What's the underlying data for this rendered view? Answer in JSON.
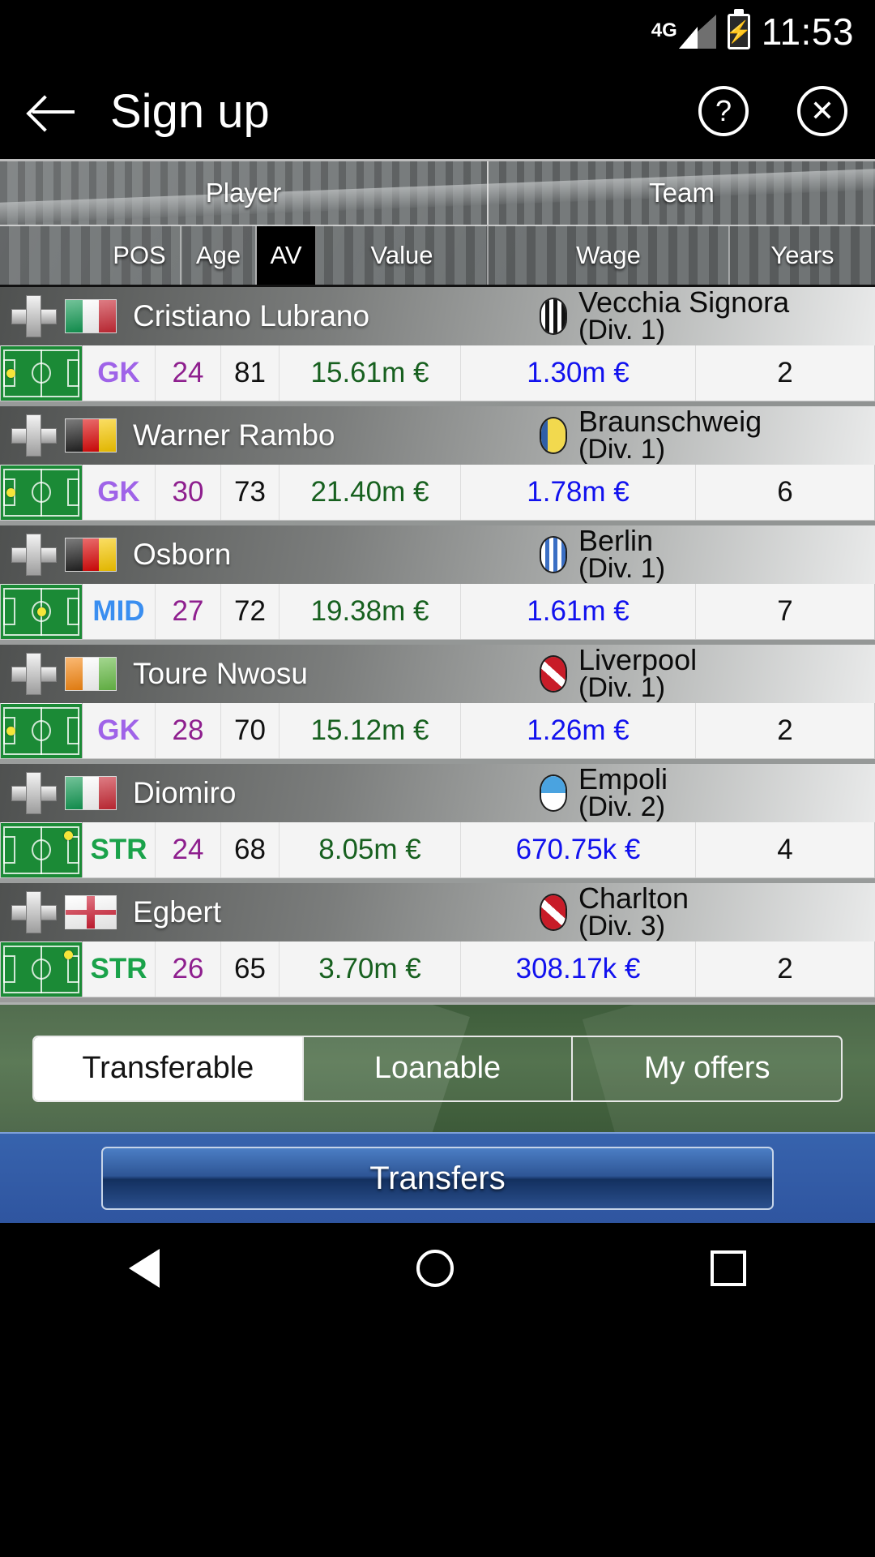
{
  "status_bar": {
    "network": "4G",
    "time": "11:53",
    "battery_icon": "battery-charging-icon"
  },
  "app_bar": {
    "title": "Sign up",
    "back_icon": "back-arrow-icon",
    "help_icon": "help-circle-icon",
    "help_glyph": "?",
    "close_icon": "close-circle-icon",
    "close_glyph": "✕"
  },
  "table": {
    "groups": [
      {
        "label": "Player"
      },
      {
        "label": "Team"
      }
    ],
    "columns": [
      {
        "label": "POS",
        "selected": false
      },
      {
        "label": "Age",
        "selected": false
      },
      {
        "label": "AV",
        "selected": true
      },
      {
        "label": "Value",
        "selected": false
      },
      {
        "label": "Wage",
        "selected": false
      },
      {
        "label": "Years",
        "selected": false
      }
    ],
    "rows": [
      {
        "name": "Cristiano Lubrano",
        "nation": "Italy",
        "team": "Vecchia Signora",
        "division": "(Div. 1)",
        "pos": "GK",
        "age": "24",
        "av": "81",
        "value": "15.61m €",
        "wage": "1.30m €",
        "years": "2"
      },
      {
        "name": "Warner Rambo",
        "nation": "Germany",
        "team": "Braunschweig",
        "division": "(Div. 1)",
        "pos": "GK",
        "age": "30",
        "av": "73",
        "value": "21.40m €",
        "wage": "1.78m €",
        "years": "6"
      },
      {
        "name": "Osborn",
        "nation": "Germany",
        "team": "Berlin",
        "division": "(Div. 1)",
        "pos": "MID",
        "age": "27",
        "av": "72",
        "value": "19.38m €",
        "wage": "1.61m €",
        "years": "7"
      },
      {
        "name": "Toure Nwosu",
        "nation": "Ivory Coast",
        "team": "Liverpool",
        "division": "(Div. 1)",
        "pos": "GK",
        "age": "28",
        "av": "70",
        "value": "15.12m €",
        "wage": "1.26m €",
        "years": "2"
      },
      {
        "name": "Diomiro",
        "nation": "Italy",
        "team": "Empoli",
        "division": "(Div. 2)",
        "pos": "STR",
        "age": "24",
        "av": "68",
        "value": "8.05m €",
        "wage": "670.75k €",
        "years": "4"
      },
      {
        "name": "Egbert",
        "nation": "England",
        "team": "Charlton",
        "division": "(Div. 3)",
        "pos": "STR",
        "age": "26",
        "av": "65",
        "value": "3.70m €",
        "wage": "308.17k €",
        "years": "2"
      }
    ]
  },
  "tabs": [
    {
      "label": "Transferable",
      "active": true
    },
    {
      "label": "Loanable",
      "active": false
    },
    {
      "label": "My offers",
      "active": false
    }
  ],
  "action_button": {
    "label": "Transfers"
  },
  "nav_bar": {
    "back_icon": "nav-back-icon",
    "home_icon": "nav-home-icon",
    "recents_icon": "nav-recents-icon"
  },
  "colors": {
    "pos_gk": "#9f63e8",
    "pos_mid": "#3a8ef0",
    "pos_str": "#1aa24a",
    "age": "#8e1f8e",
    "value": "#17601f",
    "wage": "#1111ee",
    "accent_blue": "#2f55a0",
    "pitch_green": "#1b8a36"
  },
  "flags": {
    "Italy": [
      "#009246",
      "#ffffff",
      "#ce2b37"
    ],
    "Germany": [
      "#111111",
      "#dd0000",
      "#ffce00"
    ],
    "Ivory Coast": [
      "#f77f00",
      "#ffffff",
      "#6cc24a"
    ],
    "England": [
      "cross",
      "#ffffff",
      "#cf142b"
    ]
  },
  "shields": {
    "Vecchia Signora": [
      "stripes-bw",
      "#ffffff",
      "#111111"
    ],
    "Braunschweig": [
      "solid-split",
      "#f2d94e",
      "#2f5fa8"
    ],
    "Berlin": [
      "stripes-bw",
      "#ffffff",
      "#3b6fc4"
    ],
    "Liverpool": [
      "diag",
      "#c81c28",
      "#ffffff"
    ],
    "Empoli": [
      "halves",
      "#4aa3e0",
      "#ffffff"
    ],
    "Charlton": [
      "diag",
      "#c81c28",
      "#ffffff"
    ]
  }
}
